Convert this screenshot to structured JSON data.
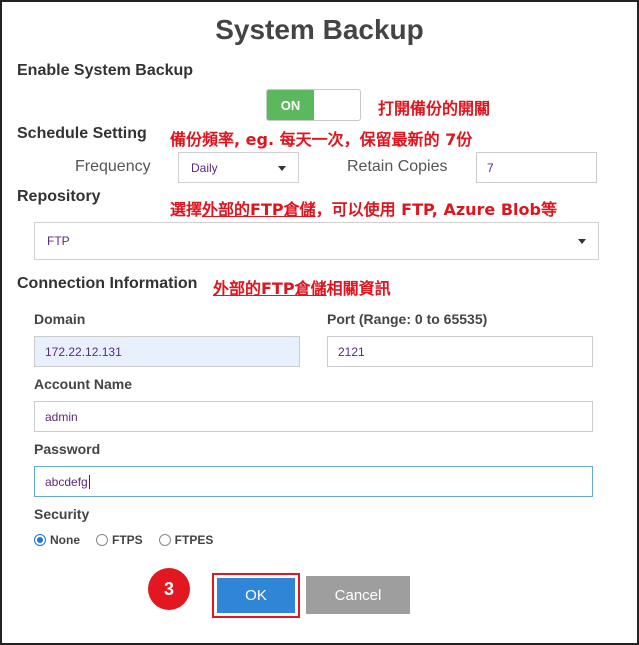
{
  "title": "System Backup",
  "enable_section": {
    "label": "Enable System Backup",
    "toggle_on_label": "ON",
    "annotation": "打開備份的開關"
  },
  "schedule_section": {
    "label": "Schedule Setting",
    "annotation": "備份頻率, eg. 每天一次，保留最新的 7份",
    "frequency_label": "Frequency",
    "frequency_value": "Daily",
    "retain_label": "Retain Copies",
    "retain_value": "7"
  },
  "repository_section": {
    "label": "Repository",
    "annotation_prefix": "選擇",
    "annotation_underlined": "外部的FTP倉儲",
    "annotation_suffix": "，可以使用 FTP, Azure Blob等",
    "value": "FTP"
  },
  "connection_section": {
    "label": "Connection Information",
    "annotation_underlined": "外部的FTP倉儲",
    "annotation_suffix": "相關資訊",
    "domain_label": "Domain",
    "domain_value": "172.22.12.131",
    "port_label": "Port (Range: 0 to 65535)",
    "port_value": "2121",
    "account_label": "Account Name",
    "account_value": "admin",
    "password_label": "Password",
    "password_value": "abcdefg",
    "security_label": "Security",
    "security_options": [
      "None",
      "FTPS",
      "FTPES"
    ],
    "security_selected": "None"
  },
  "footer": {
    "step_number": "3",
    "ok_label": "OK",
    "cancel_label": "Cancel"
  },
  "colors": {
    "annotation_red": "#e0141e",
    "toggle_green": "#5cb85c",
    "ok_blue": "#2f86d6",
    "cancel_gray": "#9e9e9e"
  }
}
